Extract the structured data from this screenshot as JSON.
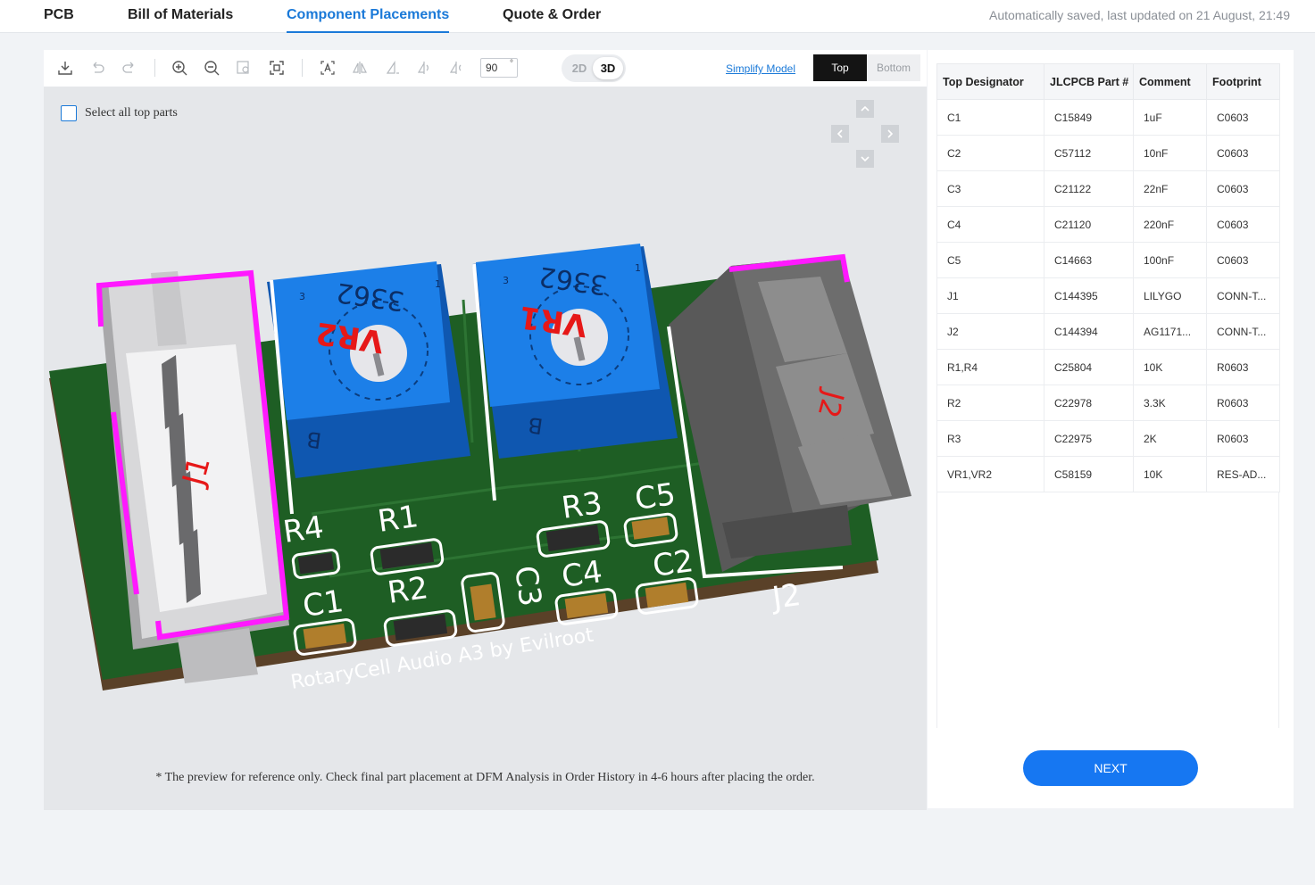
{
  "nav": {
    "tabs": [
      {
        "label": "PCB"
      },
      {
        "label": "Bill of Materials"
      },
      {
        "label": "Component Placements"
      },
      {
        "label": "Quote & Order"
      }
    ],
    "active_tab": "Component Placements",
    "saved_status": "Automatically saved, last updated on 21 August, 21:49"
  },
  "toolbar": {
    "icons": [
      "download-icon",
      "undo-icon",
      "redo-icon",
      "zoom-in-icon",
      "zoom-out-icon",
      "zoom-selection-icon",
      "fit-view-icon",
      "text-icon",
      "flip-horizontal-icon",
      "flip-vertical-icon",
      "rotate-left-icon",
      "rotate-right-icon"
    ],
    "rotation_value": "90",
    "rotation_unit": "°",
    "view_2d": "2D",
    "view_3d": "3D",
    "active_view": "3D",
    "simplify_label": "Simplify Model",
    "side_top": "Top",
    "side_bottom": "Bottom",
    "active_side": "Top"
  },
  "viewer": {
    "select_all_label": "Select all top parts",
    "note": "* The preview for reference only. Check final part placement at DFM Analysis in Order History in 4-6 hours after placing the order.",
    "board_text": "RotaryCell Audio A3 by Evilroot",
    "pcb_labels": {
      "j1": "J1",
      "j2": "J2",
      "vr1": "VR1",
      "vr2": "VR2",
      "pot_code": "3362",
      "pot_b": "B",
      "pot_1": "1",
      "pot_3": "3",
      "r1": "R1",
      "r2": "R2",
      "r3": "R3",
      "r4": "R4",
      "c1": "C1",
      "c2": "C2",
      "c3": "C3",
      "c4": "C4",
      "c5": "C5"
    }
  },
  "table": {
    "headers": [
      "Top Designator",
      "JLCPCB Part #",
      "Comment",
      "Footprint"
    ],
    "rows": [
      [
        "C1",
        "C15849",
        "1uF",
        "C0603"
      ],
      [
        "C2",
        "C57112",
        "10nF",
        "C0603"
      ],
      [
        "C3",
        "C21122",
        "22nF",
        "C0603"
      ],
      [
        "C4",
        "C21120",
        "220nF",
        "C0603"
      ],
      [
        "C5",
        "C14663",
        "100nF",
        "C0603"
      ],
      [
        "J1",
        "C144395",
        "LILYGO",
        "CONN-T..."
      ],
      [
        "J2",
        "C144394",
        "AG1171...",
        "CONN-T..."
      ],
      [
        "R1,R4",
        "C25804",
        "10K",
        "R0603"
      ],
      [
        "R2",
        "C22978",
        "3.3K",
        "R0603"
      ],
      [
        "R3",
        "C22975",
        "2K",
        "R0603"
      ],
      [
        "VR1,VR2",
        "C58159",
        "10K",
        "RES-AD..."
      ]
    ]
  },
  "next_label": "NEXT",
  "colors": {
    "accent": "#1a79d8",
    "next_button": "#1677f2",
    "pcb_green": "#1e5e24",
    "silkscreen": "#ffffff",
    "courtyard": "#ff19ff",
    "pot_blue": "#1c7fe8",
    "designator_red": "#e61818"
  }
}
